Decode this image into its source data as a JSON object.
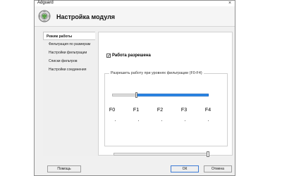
{
  "window": {
    "title": "Adguard",
    "close_glyph": "×"
  },
  "header": {
    "title": "Настройка модуля",
    "logo_icon": "gear-shield-icon"
  },
  "sidebar": {
    "items": [
      {
        "label": "Режим работы",
        "active": true
      },
      {
        "label": "Фильтрация по размерам",
        "active": false
      },
      {
        "label": "Настройки фильтрации",
        "active": false
      },
      {
        "label": "Списки фильтров",
        "active": false
      },
      {
        "label": "Настройки соединения",
        "active": false
      }
    ]
  },
  "content": {
    "checkbox": {
      "label": "Работа разрешена",
      "checked": true
    },
    "group": {
      "label": "Разрешить работу при уровнях фильтрации (F0-F4)"
    },
    "filter_levels": [
      "F0",
      "F1",
      "F2",
      "F3",
      "F4"
    ],
    "range_start_index": 1,
    "range_end_index": 4,
    "bottom_slider_value": 1.0
  },
  "buttons": {
    "help": "Помощь",
    "ok": "ОК",
    "cancel": "Отмена"
  },
  "colors": {
    "accent": "#2f8bea"
  }
}
